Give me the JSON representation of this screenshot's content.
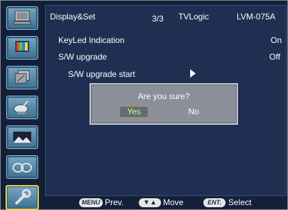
{
  "header": {
    "title": "Display&Set",
    "page": "3/3",
    "brand": "TVLogic",
    "model": "LVM-075A"
  },
  "menu": {
    "items": [
      {
        "label": "KeyLed Indication",
        "value": "On"
      },
      {
        "label": "S/W upgrade",
        "value": "Off"
      },
      {
        "label": "S/W upgrade start",
        "value": ""
      }
    ]
  },
  "dialog": {
    "prompt": "Are you sure?",
    "yes_label": "Yes",
    "no_label": "No"
  },
  "footer": {
    "menu_key": "MENU",
    "menu_action": "Prev.",
    "move_key": "▼▲",
    "move_action": "Move",
    "ent_key": "ENT.",
    "ent_action": "Select"
  },
  "sidebar": {
    "icons": [
      "monitor-icon",
      "color-monitor-icon",
      "copy-monitor-icon",
      "satellite-dish-icon",
      "landscape-icon",
      "glasses-icon",
      "wrench-icon"
    ],
    "active_index": 6
  },
  "colors": {
    "background": "#14203a",
    "panel": "#1f2f52",
    "dialog": "#8a8f99",
    "highlight_border": "#d9862c",
    "active_icon_border": "#e8d74a"
  }
}
